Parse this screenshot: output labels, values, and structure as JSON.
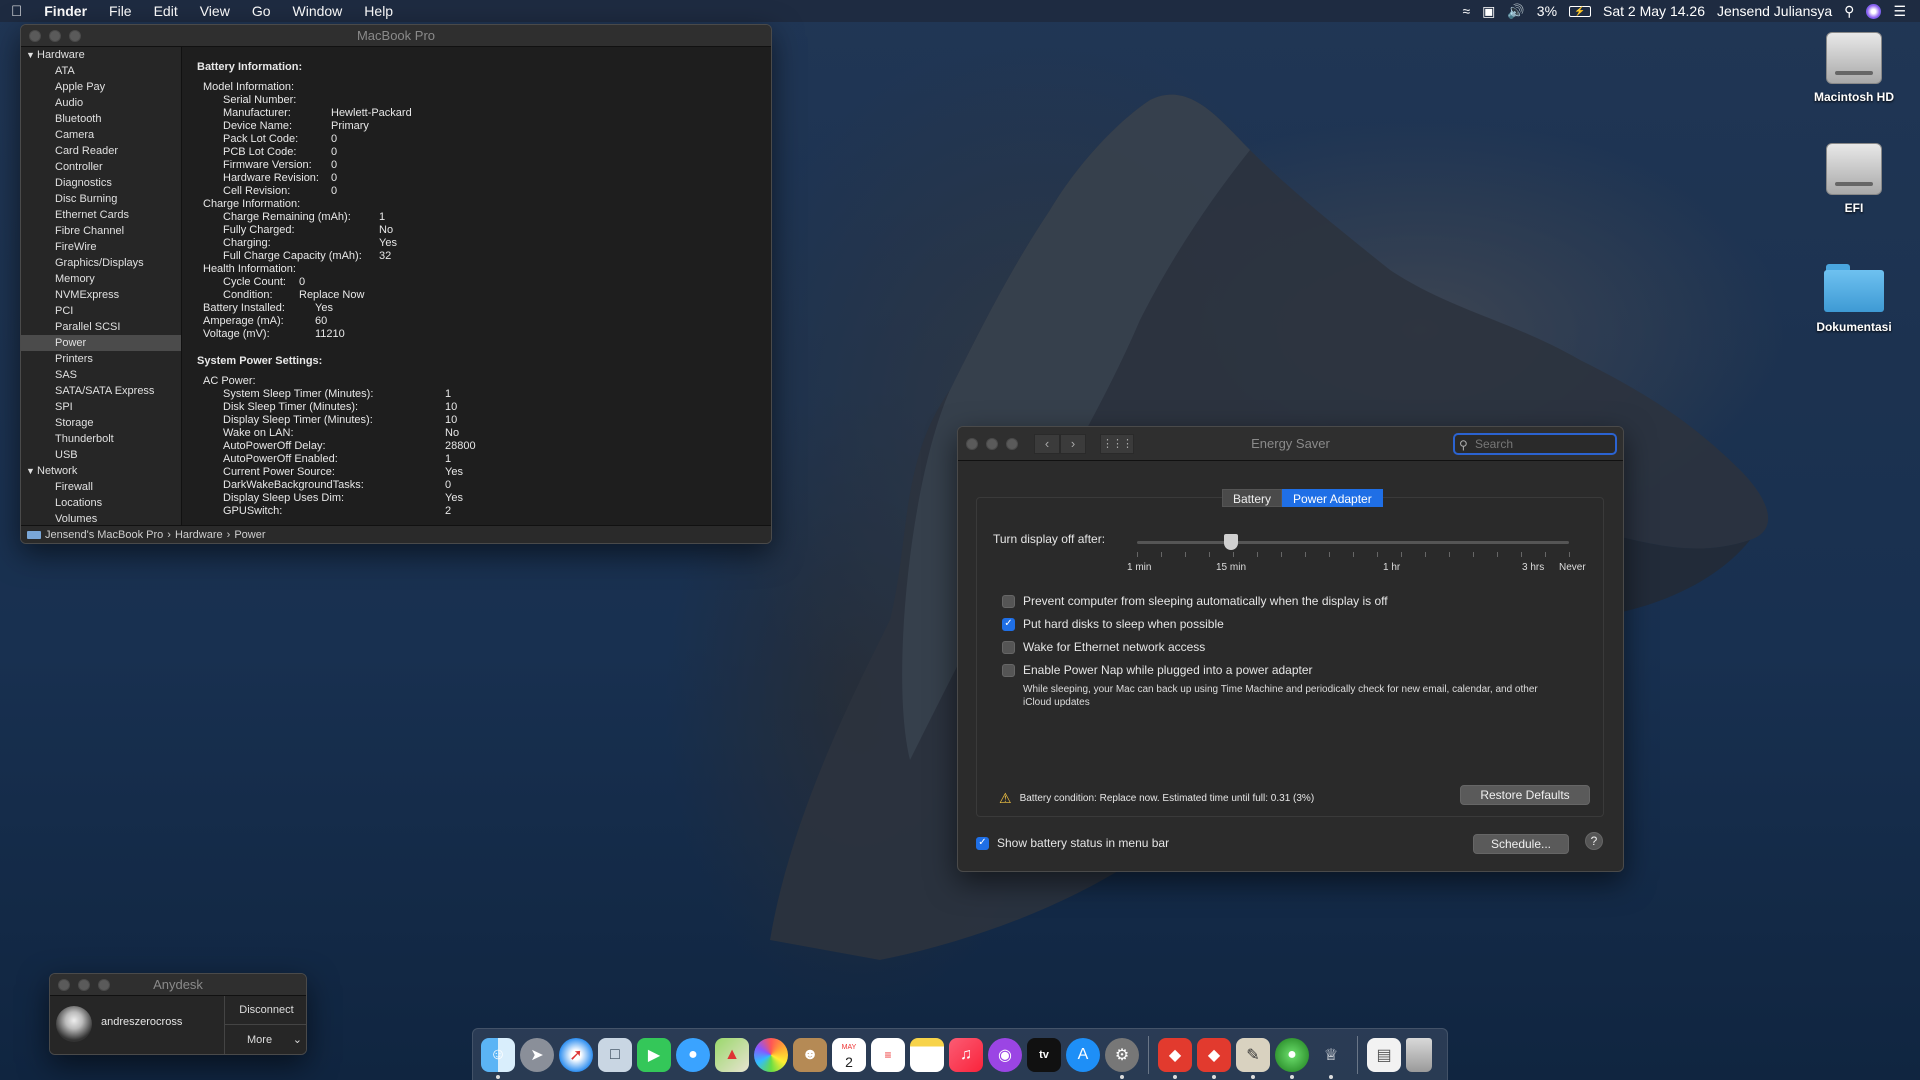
{
  "menubar": {
    "apple_icon": "apple-icon",
    "app": "Finder",
    "items": [
      "File",
      "Edit",
      "View",
      "Go",
      "Window",
      "Help"
    ],
    "battery_percent": "3%",
    "datetime": "Sat 2 May  14.26",
    "user": "Jensend Juliansya"
  },
  "system_info": {
    "title": "MacBook Pro",
    "sidebar": {
      "hardware": "Hardware",
      "hardware_items": [
        "ATA",
        "Apple Pay",
        "Audio",
        "Bluetooth",
        "Camera",
        "Card Reader",
        "Controller",
        "Diagnostics",
        "Disc Burning",
        "Ethernet Cards",
        "Fibre Channel",
        "FireWire",
        "Graphics/Displays",
        "Memory",
        "NVMExpress",
        "PCI",
        "Parallel SCSI",
        "Power",
        "Printers",
        "SAS",
        "SATA/SATA Express",
        "SPI",
        "Storage",
        "Thunderbolt",
        "USB"
      ],
      "selected": "Power",
      "network": "Network",
      "network_items": [
        "Firewall",
        "Locations",
        "Volumes"
      ]
    },
    "battery_header": "Battery Information:",
    "model_header": "Model Information:",
    "model": [
      {
        "k": "Serial Number:",
        "v": ""
      },
      {
        "k": "Manufacturer:",
        "v": "Hewlett-Packard"
      },
      {
        "k": "Device Name:",
        "v": "Primary"
      },
      {
        "k": "Pack Lot Code:",
        "v": "0"
      },
      {
        "k": "PCB Lot Code:",
        "v": "0"
      },
      {
        "k": "Firmware Version:",
        "v": "0"
      },
      {
        "k": "Hardware Revision:",
        "v": "0"
      },
      {
        "k": "Cell Revision:",
        "v": "0"
      }
    ],
    "charge_header": "Charge Information:",
    "charge": [
      {
        "k": "Charge Remaining (mAh):",
        "v": "1"
      },
      {
        "k": "Fully Charged:",
        "v": "No"
      },
      {
        "k": "Charging:",
        "v": "Yes"
      },
      {
        "k": "Full Charge Capacity (mAh):",
        "v": "32"
      }
    ],
    "health_header": "Health Information:",
    "health": [
      {
        "k": "Cycle Count:",
        "v": "0"
      },
      {
        "k": "Condition:",
        "v": "Replace Now"
      }
    ],
    "battery_misc": [
      {
        "k": "Battery Installed:",
        "v": "Yes"
      },
      {
        "k": "Amperage (mA):",
        "v": "60"
      },
      {
        "k": "Voltage (mV):",
        "v": "11210"
      }
    ],
    "power_header": "System Power Settings:",
    "ac_header": "AC Power:",
    "ac": [
      {
        "k": "System Sleep Timer (Minutes):",
        "v": "1"
      },
      {
        "k": "Disk Sleep Timer (Minutes):",
        "v": "10"
      },
      {
        "k": "Display Sleep Timer (Minutes):",
        "v": "10"
      },
      {
        "k": "Wake on LAN:",
        "v": "No"
      },
      {
        "k": "AutoPowerOff Delay:",
        "v": "28800"
      },
      {
        "k": "AutoPowerOff Enabled:",
        "v": "1"
      },
      {
        "k": "Current Power Source:",
        "v": "Yes"
      },
      {
        "k": "DarkWakeBackgroundTasks:",
        "v": "0"
      },
      {
        "k": "Display Sleep Uses Dim:",
        "v": "Yes"
      },
      {
        "k": "GPUSwitch:",
        "v": "2"
      }
    ],
    "path": [
      "Jensend's MacBook Pro",
      "Hardware",
      "Power"
    ]
  },
  "energy_saver": {
    "title": "Energy Saver",
    "search_placeholder": "Search",
    "tabs": [
      "Battery",
      "Power Adapter"
    ],
    "active_tab": "Power Adapter",
    "slider_label": "Turn display off after:",
    "slider_ticks": [
      "1 min",
      "15 min",
      "1 hr",
      "3 hrs",
      "Never"
    ],
    "slider_value": "15 min",
    "options": [
      {
        "label": "Prevent computer from sleeping automatically when the display is off",
        "checked": false
      },
      {
        "label": "Put hard disks to sleep when possible",
        "checked": true
      },
      {
        "label": "Wake for Ethernet network access",
        "checked": false
      },
      {
        "label": "Enable Power Nap while plugged into a power adapter",
        "checked": false
      }
    ],
    "powernap_note": "While sleeping, your Mac can back up using Time Machine and periodically check for new email, calendar, and other iCloud updates",
    "warning": "Battery condition: Replace now. Estimated time until full: 0.31 (3%)",
    "restore_button": "Restore Defaults",
    "show_battery": "Show battery status in menu bar",
    "show_battery_checked": true,
    "schedule_button": "Schedule...",
    "help": "?"
  },
  "desktop": {
    "icons": [
      "Macintosh HD",
      "EFI",
      "Dokumentasi"
    ]
  },
  "anydesk": {
    "title": "Anydesk",
    "user": "andreszerocross",
    "disconnect": "Disconnect",
    "more": "More"
  },
  "dock": {
    "calendar_day": "2",
    "calendar_month": "MAY",
    "tv_label": "tv"
  }
}
